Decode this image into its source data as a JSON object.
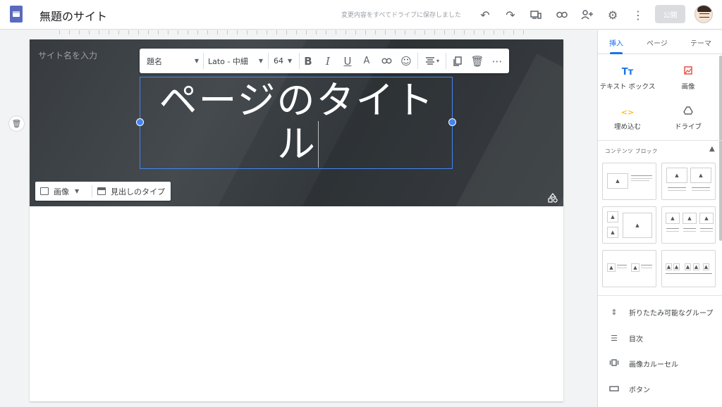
{
  "header": {
    "site_title": "無題のサイト",
    "save_status": "変更内容をすべてドライブに保存しました",
    "publish_label": "公開",
    "icons": [
      "undo-icon",
      "redo-icon",
      "preview-icon",
      "link-icon",
      "share-icon",
      "settings-icon",
      "more-vert-icon"
    ]
  },
  "canvas": {
    "site_name_placeholder": "サイト名を入力",
    "title_text": "ページのタイトル",
    "toolbar": {
      "style_label": "題名",
      "font_label": "Lato - 中細",
      "size_label": "64"
    },
    "image_button_label": "画像",
    "header_type_label": "見出しのタイプ"
  },
  "panel": {
    "tabs": [
      "挿入",
      "ページ",
      "テーマ"
    ],
    "active_tab": "挿入",
    "insert_items": [
      {
        "label": "テキスト ボックス",
        "icon": "text-box-icon"
      },
      {
        "label": "画像",
        "icon": "image-icon"
      },
      {
        "label": "埋め込む",
        "icon": "embed-icon"
      },
      {
        "label": "ドライブ",
        "icon": "drive-icon"
      }
    ],
    "content_blocks_label": "コンテンツ ブロック",
    "list_items": [
      {
        "label": "折りたたみ可能なグループ",
        "icon": "collapsible-group-icon"
      },
      {
        "label": "目次",
        "icon": "table-of-contents-icon"
      },
      {
        "label": "画像カルーセル",
        "icon": "image-carousel-icon"
      },
      {
        "label": "ボタン",
        "icon": "button-icon"
      }
    ]
  },
  "colors": {
    "accent": "#1a73e8",
    "selection": "#4285f4",
    "header_bg": "#33383c"
  }
}
